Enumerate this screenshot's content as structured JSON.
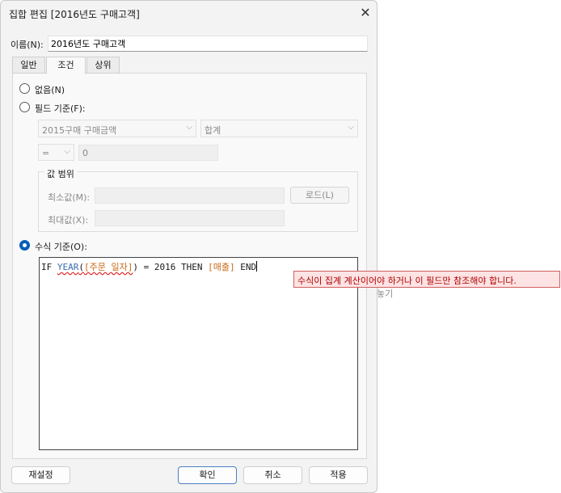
{
  "window": {
    "title": "집합 편집 [2016년도 구매고객]"
  },
  "name": {
    "label": "이름(N):",
    "value": "2016년도 구매고객"
  },
  "tabs": [
    {
      "label": "일반"
    },
    {
      "label": "조건"
    },
    {
      "label": "상위"
    }
  ],
  "condition": {
    "none_label": "없음(N)",
    "by_field_label": "필드 기준(F):",
    "field_combo": "2015구매 구매금액",
    "agg_combo": "합계",
    "operator": "=",
    "value": "0",
    "range": {
      "label": "값 범위",
      "min_label": "최소값(M):",
      "max_label": "최대값(X):",
      "load_button": "로드(L)"
    },
    "by_formula_label": "수식 기준(O):",
    "formula": {
      "t1": "IF ",
      "t2": "YEAR",
      "t3": "(",
      "t4": "[주문 일자]",
      "t5": ") = 2016 THEN ",
      "t6": "[매출]",
      "t7": " END"
    },
    "error_tooltip": "수식이 집계 계산이어야 하거나 이 필드만 참조해야 합니다.",
    "obscured_text": "놓기",
    "selected": "by_formula"
  },
  "buttons": {
    "reset": "재설정",
    "ok": "확인",
    "cancel": "취소",
    "apply": "적용"
  }
}
